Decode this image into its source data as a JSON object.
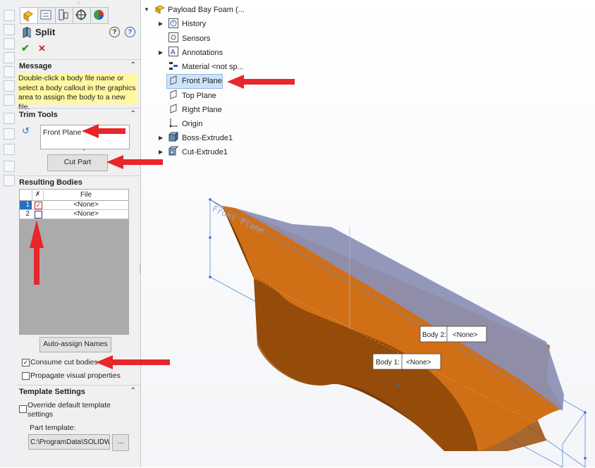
{
  "panel": {
    "title": "Split",
    "message_header": "Message",
    "message_text": "Double-click a body file name or select a body callout in the graphics area to assign the body to a new file.",
    "trim_tools_header": "Trim Tools",
    "trim_tool_value": "Front Plane",
    "cut_part_label": "Cut Part",
    "resulting_bodies_header": "Resulting Bodies",
    "table": {
      "col_check": "✗",
      "col_file": "File",
      "rows": [
        {
          "index": "1",
          "file": "<None>",
          "checked": true
        },
        {
          "index": "2",
          "file": "<None>",
          "checked": false
        }
      ]
    },
    "auto_assign_label": "Auto-assign Names",
    "consume_label": "Consume cut bodies",
    "propagate_label": "Propagate visual properties",
    "template_header": "Template Settings",
    "override_label": "Override default template settings",
    "part_template_label": "Part template:",
    "part_template_value": "C:\\ProgramData\\SOLIDWC",
    "browse_label": "..."
  },
  "tree": {
    "root": "Payload Bay Foam  (...",
    "items": [
      "History",
      "Sensors",
      "Annotations",
      "Material <not sp...",
      "Front Plane",
      "Top Plane",
      "Right Plane",
      "Origin",
      "Boss-Extrude1",
      "Cut-Extrude1"
    ]
  },
  "graphics": {
    "plane_label": "Front Plane",
    "body1_name": "Body  1:",
    "body1_value": "<None>",
    "body2_name": "Body  2:",
    "body2_value": "<None>"
  },
  "colors": {
    "accent_arrow": "#e8262b",
    "body_orange": "#d06f16",
    "plane_blue": "#7f86a8",
    "message_bg": "#fff8a0"
  }
}
